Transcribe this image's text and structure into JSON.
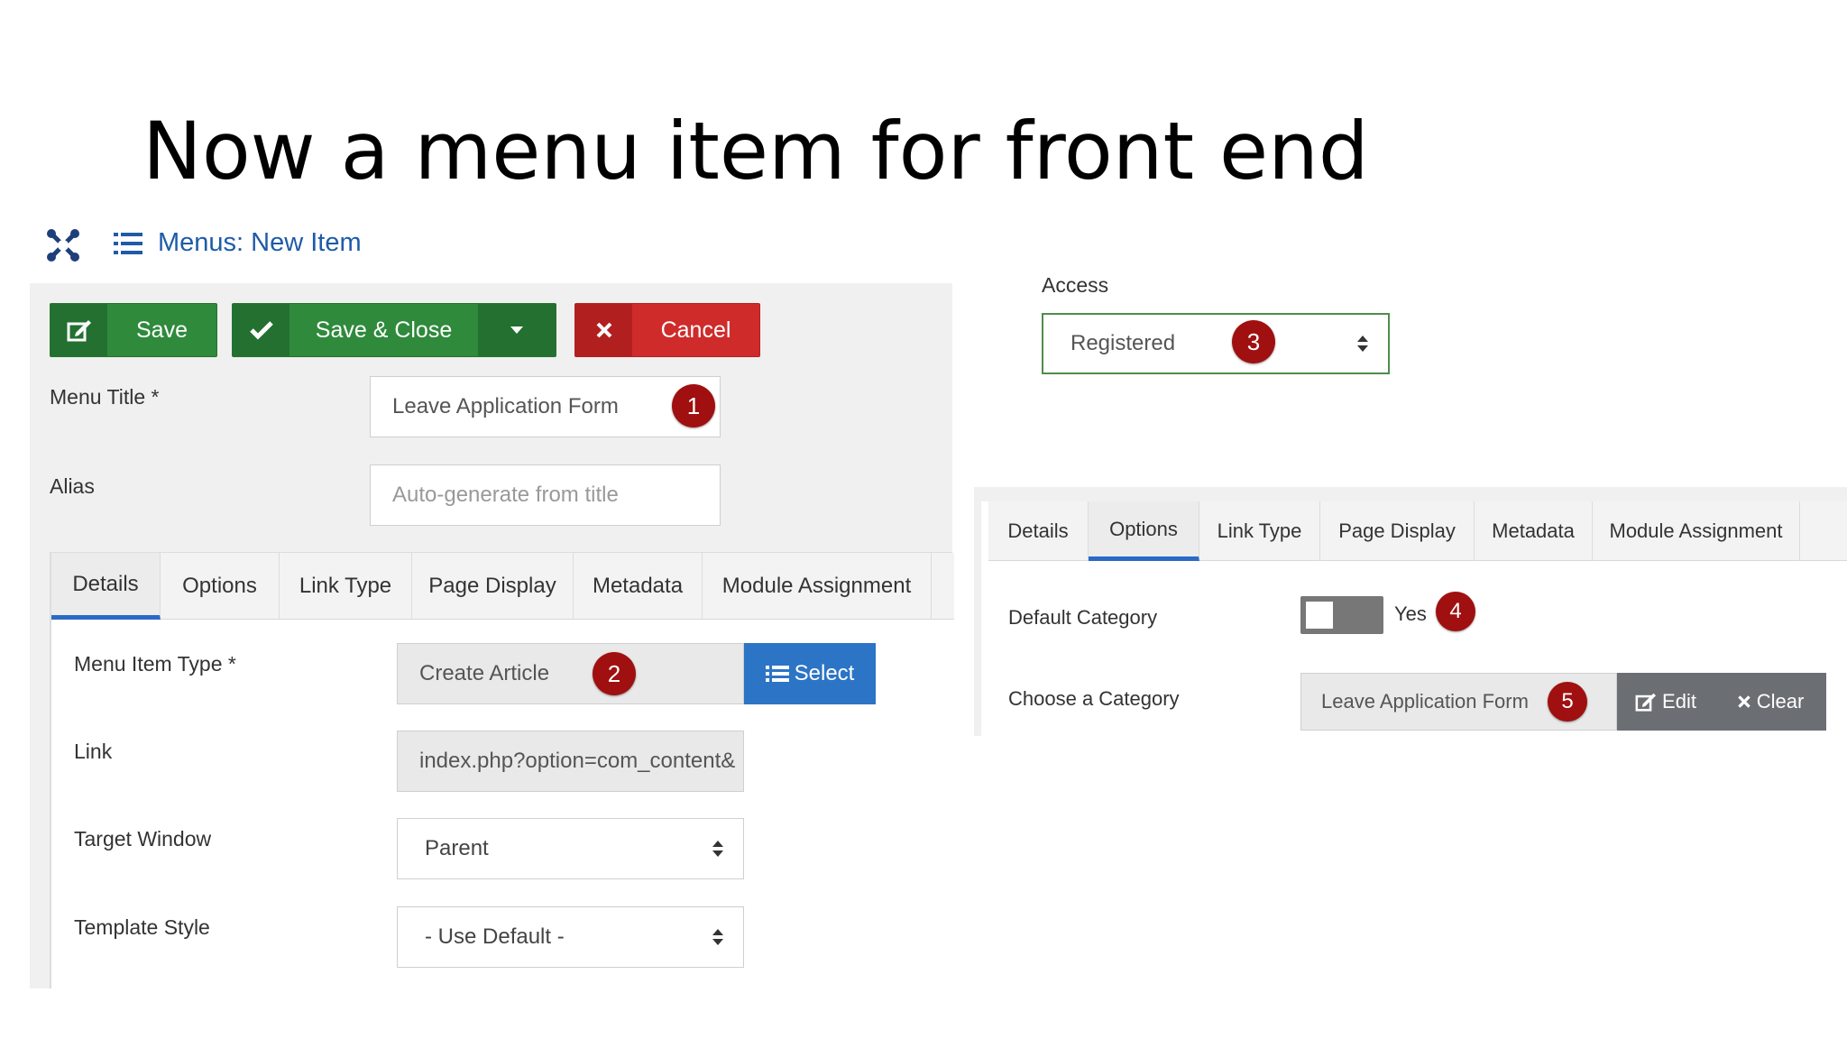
{
  "slide": {
    "title": "Now a menu item for front end"
  },
  "header": {
    "title": "Menus: New Item"
  },
  "toolbar": {
    "save_label": "Save",
    "save_close_label": "Save & Close",
    "cancel_label": "Cancel"
  },
  "form": {
    "menu_title_label": "Menu Title *",
    "menu_title_value": "Leave Application Form",
    "alias_label": "Alias",
    "alias_placeholder": "Auto-generate from title"
  },
  "tabs": [
    "Details",
    "Options",
    "Link Type",
    "Page Display",
    "Metadata",
    "Module Assignment"
  ],
  "details": {
    "menu_item_type_label": "Menu Item Type *",
    "menu_item_type_value": "Create Article",
    "select_label": "Select",
    "link_label": "Link",
    "link_value": "index.php?option=com_content&",
    "target_window_label": "Target Window",
    "target_window_value": "Parent",
    "template_style_label": "Template Style",
    "template_style_value": "- Use Default -"
  },
  "access": {
    "label": "Access",
    "value": "Registered"
  },
  "options_panel": {
    "tabs": [
      "Details",
      "Options",
      "Link Type",
      "Page Display",
      "Metadata",
      "Module Assignment"
    ],
    "default_category_label": "Default Category",
    "default_category_value": "Yes",
    "choose_category_label": "Choose a Category",
    "choose_category_value": "Leave Application Form",
    "edit_label": "Edit",
    "clear_label": "Clear"
  },
  "badges": [
    "1",
    "2",
    "3",
    "4",
    "5"
  ],
  "colors": {
    "green": "#2f8a3c",
    "red": "#cf2b2b",
    "blue": "#2c74c6",
    "badge": "#a01010",
    "heading_blue": "#1e5ba8"
  }
}
